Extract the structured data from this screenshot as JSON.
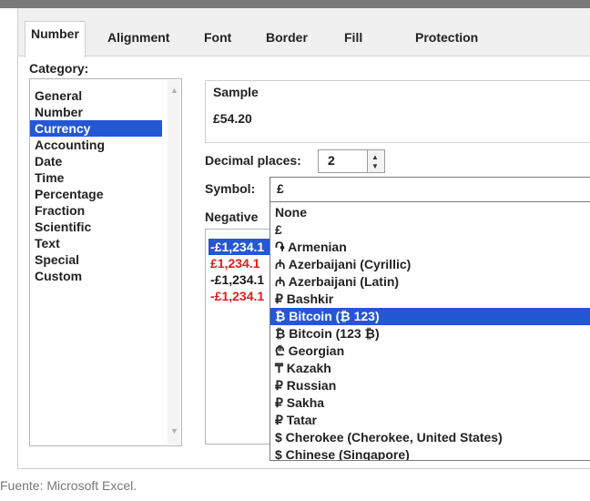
{
  "tabs": [
    "Number",
    "Alignment",
    "Font",
    "Border",
    "Fill",
    "Protection"
  ],
  "category": {
    "label": "Category:",
    "items": [
      "General",
      "Number",
      "Currency",
      "Accounting",
      "Date",
      "Time",
      "Percentage",
      "Fraction",
      "Scientific",
      "Text",
      "Special",
      "Custom"
    ],
    "selected": "Currency"
  },
  "sample": {
    "label": "Sample",
    "value": "£54.20"
  },
  "decimal_places": {
    "label": "Decimal places:",
    "value": "2"
  },
  "symbol": {
    "label": "Symbol:",
    "value": "£",
    "options": [
      "None",
      "£",
      "֏ Armenian",
      "₼ Azerbaijani (Cyrillic)",
      "₼ Azerbaijani (Latin)",
      "₽ Bashkir",
      "₿ Bitcoin (₿ 123)",
      "₿ Bitcoin (123 ₿)",
      "₾ Georgian",
      "₸ Kazakh",
      "₽ Russian",
      "₽ Sakha",
      "₽ Tatar",
      "$ Cherokee (Cherokee, United States)",
      "$ Chinese (Singapore)"
    ],
    "selected": "₿ Bitcoin (₿ 123)"
  },
  "negative": {
    "label": "Negative",
    "items": [
      "-£1,234.1",
      "£1,234.1",
      "-£1,234.1",
      "-£1,234.1"
    ]
  },
  "caption": "Fuente:  Microsoft Excel.",
  "colors": {
    "selection": "#2457d4",
    "negative_red": "#e41b1b"
  }
}
